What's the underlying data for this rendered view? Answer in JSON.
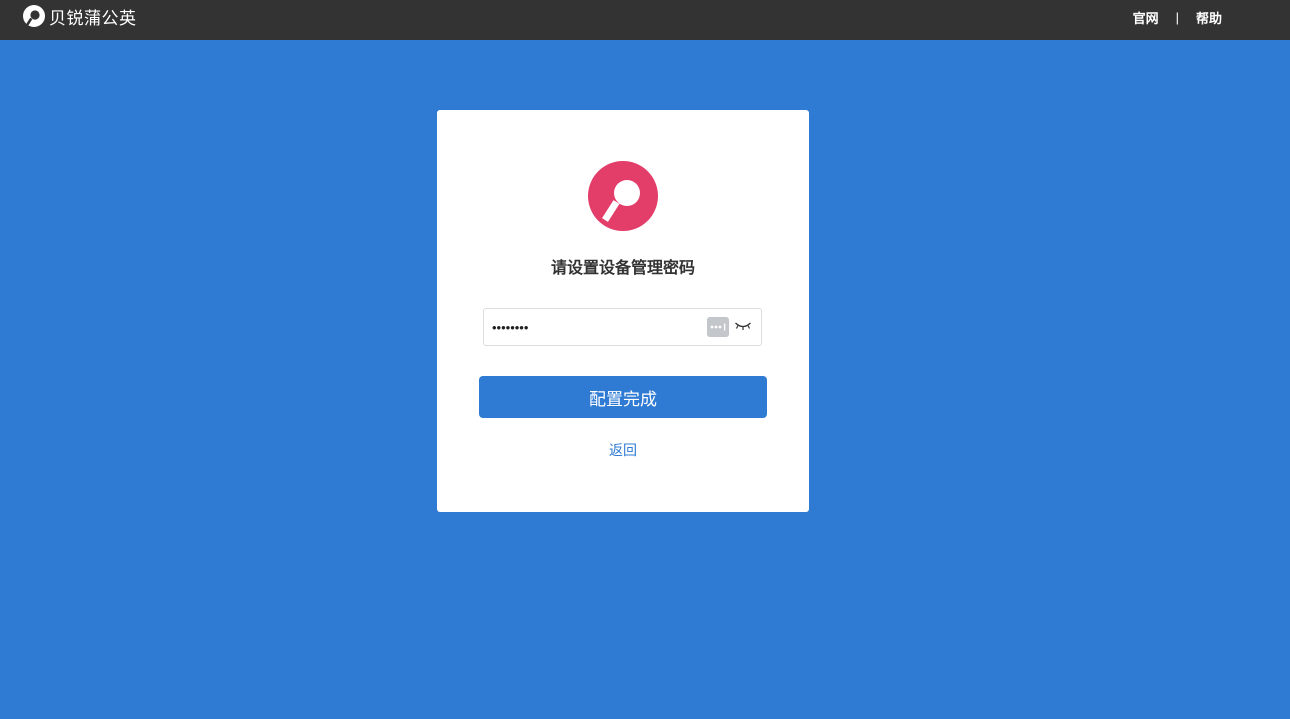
{
  "header": {
    "brand_name": "贝锐蒲公英",
    "nav": {
      "official_site": "官网",
      "separator": "|",
      "help": "帮助"
    }
  },
  "card": {
    "title": "请设置设备管理密码",
    "password": {
      "value": "12345678",
      "type": "password"
    },
    "submit_label": "配置完成",
    "back_label": "返回"
  },
  "colors": {
    "background": "#2f7bd4",
    "topbar": "#333333",
    "accent": "#2f7bd4",
    "logo": "#e33d6a"
  },
  "icons": {
    "brand": "dandelion-logo-icon",
    "card": "dandelion-logo-icon",
    "password_manager": "password-key-icon",
    "visibility": "eye-closed-icon"
  }
}
